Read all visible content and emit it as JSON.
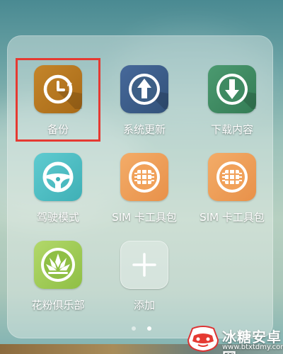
{
  "colors": {
    "highlight": "#e53a32",
    "backup_icon": "#b9781e",
    "system_update_icon": "#3d5f86",
    "download_icon": "#3f8a62",
    "driving_icon": "#4fc0c6",
    "sim_icon": "#f1a15a",
    "huafen_icon": "#a3cf5a"
  },
  "folder": {
    "apps": [
      {
        "label": "备份",
        "icon": "backup-clock-icon"
      },
      {
        "label": "系统更新",
        "icon": "arrow-up-icon"
      },
      {
        "label": "下载内容",
        "icon": "arrow-down-icon"
      },
      {
        "label": "驾驶模式",
        "icon": "steering-wheel-icon"
      },
      {
        "label": "SIM 卡工具包",
        "icon": "sim-card-icon"
      },
      {
        "label": "SIM 卡工具包",
        "icon": "sim-card-icon"
      },
      {
        "label": "花粉俱乐部",
        "icon": "lotus-icon"
      },
      {
        "label": "添加",
        "icon": "plus-icon"
      }
    ]
  },
  "pagination": {
    "total": 2,
    "active": 2
  },
  "watermark": {
    "name": "冰糖安卓网",
    "url": "www.btxtdmy.com"
  }
}
